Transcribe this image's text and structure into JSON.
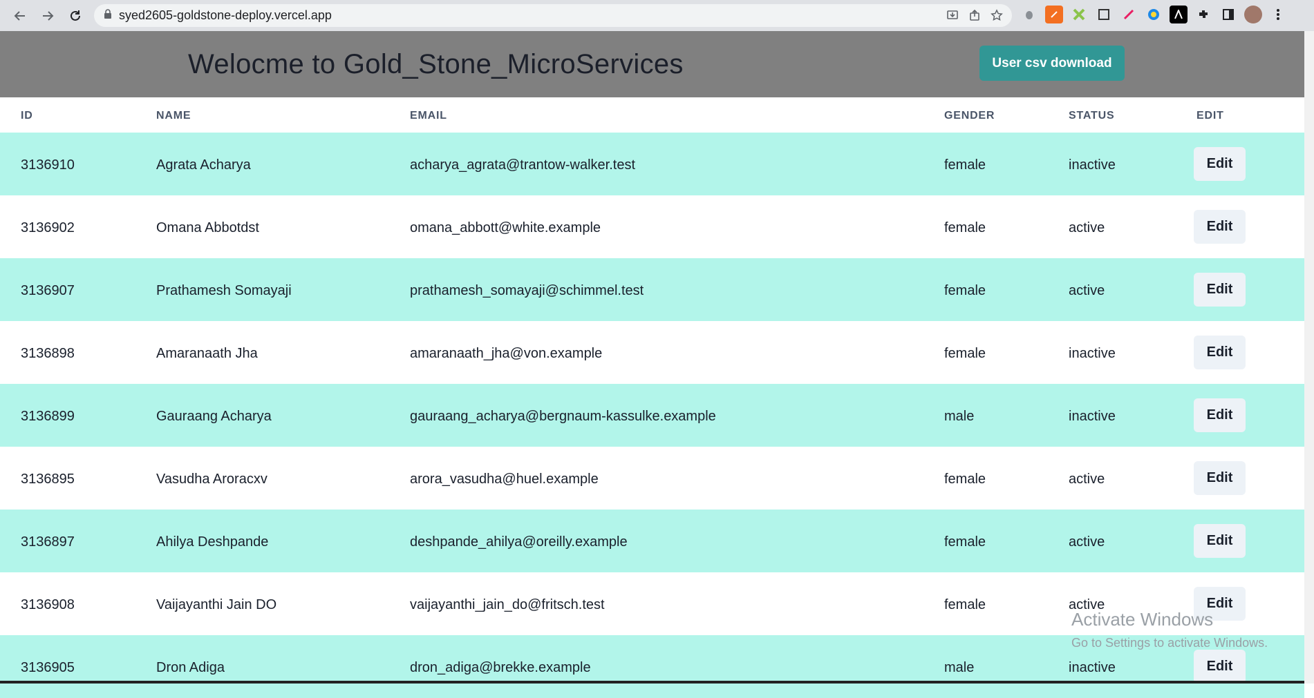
{
  "browser": {
    "url": "syed2605-goldstone-deploy.vercel.app"
  },
  "header": {
    "title": "Welocme to Gold_Stone_MicroServices",
    "csv_button": "User csv download"
  },
  "table": {
    "columns": [
      "ID",
      "NAME",
      "EMAIL",
      "GENDER",
      "STATUS",
      "EDIT"
    ],
    "rows": [
      {
        "id": "3136910",
        "name": "Agrata Acharya",
        "email": "acharya_agrata@trantow-walker.test",
        "gender": "female",
        "status": "inactive",
        "edit": "Edit"
      },
      {
        "id": "3136902",
        "name": "Omana Abbotdst",
        "email": "omana_abbott@white.example",
        "gender": "female",
        "status": "active",
        "edit": "Edit"
      },
      {
        "id": "3136907",
        "name": "Prathamesh Somayaji",
        "email": "prathamesh_somayaji@schimmel.test",
        "gender": "female",
        "status": "active",
        "edit": "Edit"
      },
      {
        "id": "3136898",
        "name": "Amaranaath Jha",
        "email": "amaranaath_jha@von.example",
        "gender": "female",
        "status": "inactive",
        "edit": "Edit"
      },
      {
        "id": "3136899",
        "name": "Gauraang Acharya",
        "email": "gauraang_acharya@bergnaum-kassulke.example",
        "gender": "male",
        "status": "inactive",
        "edit": "Edit"
      },
      {
        "id": "3136895",
        "name": "Vasudha Aroracxv",
        "email": "arora_vasudha@huel.example",
        "gender": "female",
        "status": "active",
        "edit": "Edit"
      },
      {
        "id": "3136897",
        "name": "Ahilya Deshpande",
        "email": "deshpande_ahilya@oreilly.example",
        "gender": "female",
        "status": "active",
        "edit": "Edit"
      },
      {
        "id": "3136908",
        "name": "Vaijayanthi Jain DO",
        "email": "vaijayanthi_jain_do@fritsch.test",
        "gender": "female",
        "status": "active",
        "edit": "Edit"
      },
      {
        "id": "3136905",
        "name": "Dron Adiga",
        "email": "dron_adiga@brekke.example",
        "gender": "male",
        "status": "inactive",
        "edit": "Edit"
      }
    ]
  },
  "watermark": {
    "line1": "Activate Windows",
    "line2": "Go to Settings to activate Windows."
  },
  "colors": {
    "header_bg": "#808080",
    "accent": "#319795",
    "row_alt": "#b2f5ea"
  }
}
